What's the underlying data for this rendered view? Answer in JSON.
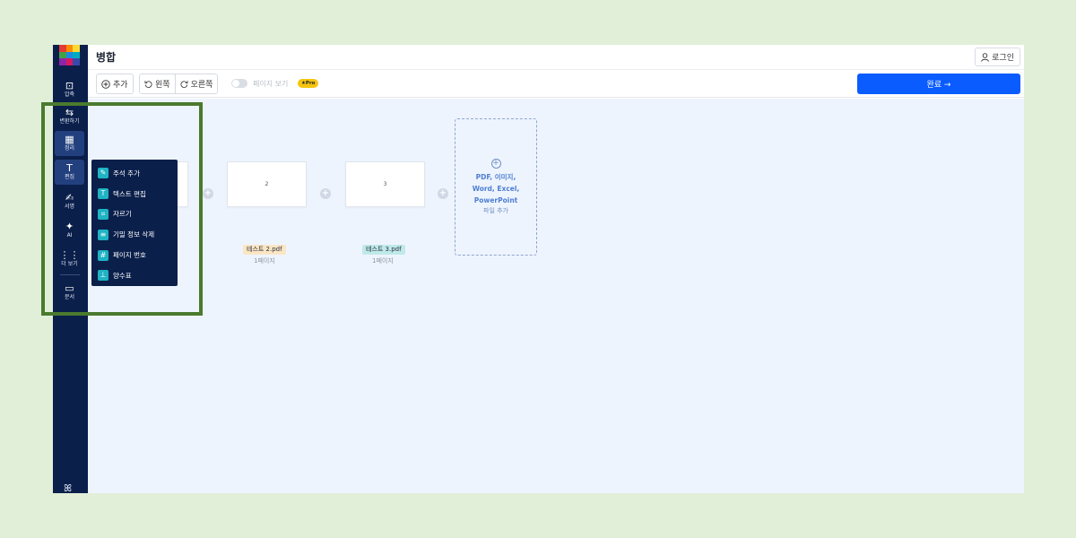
{
  "header": {
    "title": "병합",
    "login_label": "로그인"
  },
  "toolbar": {
    "add_label": "추가",
    "rotate_left_label": "왼쪽",
    "rotate_right_label": "오른쪽",
    "page_view_label": "페이지 보기",
    "page_view_enabled": false,
    "pro_badge": "★Pro",
    "done_label": "완료 →"
  },
  "sidebar": {
    "items": [
      {
        "label": "압축",
        "icon": "compress-icon",
        "glyph": "⊡"
      },
      {
        "label": "변환하기",
        "icon": "convert-icon",
        "glyph": "⇆"
      },
      {
        "label": "정리",
        "icon": "grid-icon",
        "glyph": "▦"
      },
      {
        "label": "편집",
        "icon": "text-edit-icon",
        "glyph": "T"
      },
      {
        "label": "서명",
        "icon": "signature-icon",
        "glyph": "✍"
      },
      {
        "label": "AI",
        "icon": "sparkle-icon",
        "glyph": "✦"
      },
      {
        "label": "더 보기",
        "icon": "apps-icon",
        "glyph": "⋮⋮"
      },
      {
        "label": "문서",
        "icon": "folder-icon",
        "glyph": "▭"
      }
    ],
    "active": "정리",
    "user_glyph": "ꕤ"
  },
  "edit_menu": {
    "items": [
      {
        "label": "주석 추가",
        "icon": "annotate-icon",
        "glyph": "✎"
      },
      {
        "label": "텍스트 편집",
        "icon": "text-edit-icon",
        "glyph": "T"
      },
      {
        "label": "자르기",
        "icon": "crop-icon",
        "glyph": "⌗"
      },
      {
        "label": "기밀 정보 삭제",
        "icon": "redact-icon",
        "glyph": "≡"
      },
      {
        "label": "페이지 번호",
        "icon": "page-number-icon",
        "glyph": "#"
      },
      {
        "label": "양수표",
        "icon": "stamp-icon",
        "glyph": "⊥"
      }
    ]
  },
  "files": [
    {
      "page_number": "2",
      "name": "테스트 2.pdf",
      "pages": "1페이지",
      "tag_color": "orange"
    },
    {
      "page_number": "3",
      "name": "테스트 3.pdf",
      "pages": "1페이지",
      "tag_color": "teal"
    }
  ],
  "add_file_box": {
    "types": "PDF, 이미지,\nWord, Excel,\nPowerPoint",
    "label": "파일 추가"
  },
  "colors": {
    "sidebar": "#0b1f4b",
    "accent": "#0a5cff",
    "highlight": "#4b7a2e",
    "background": "#e2efd8"
  }
}
